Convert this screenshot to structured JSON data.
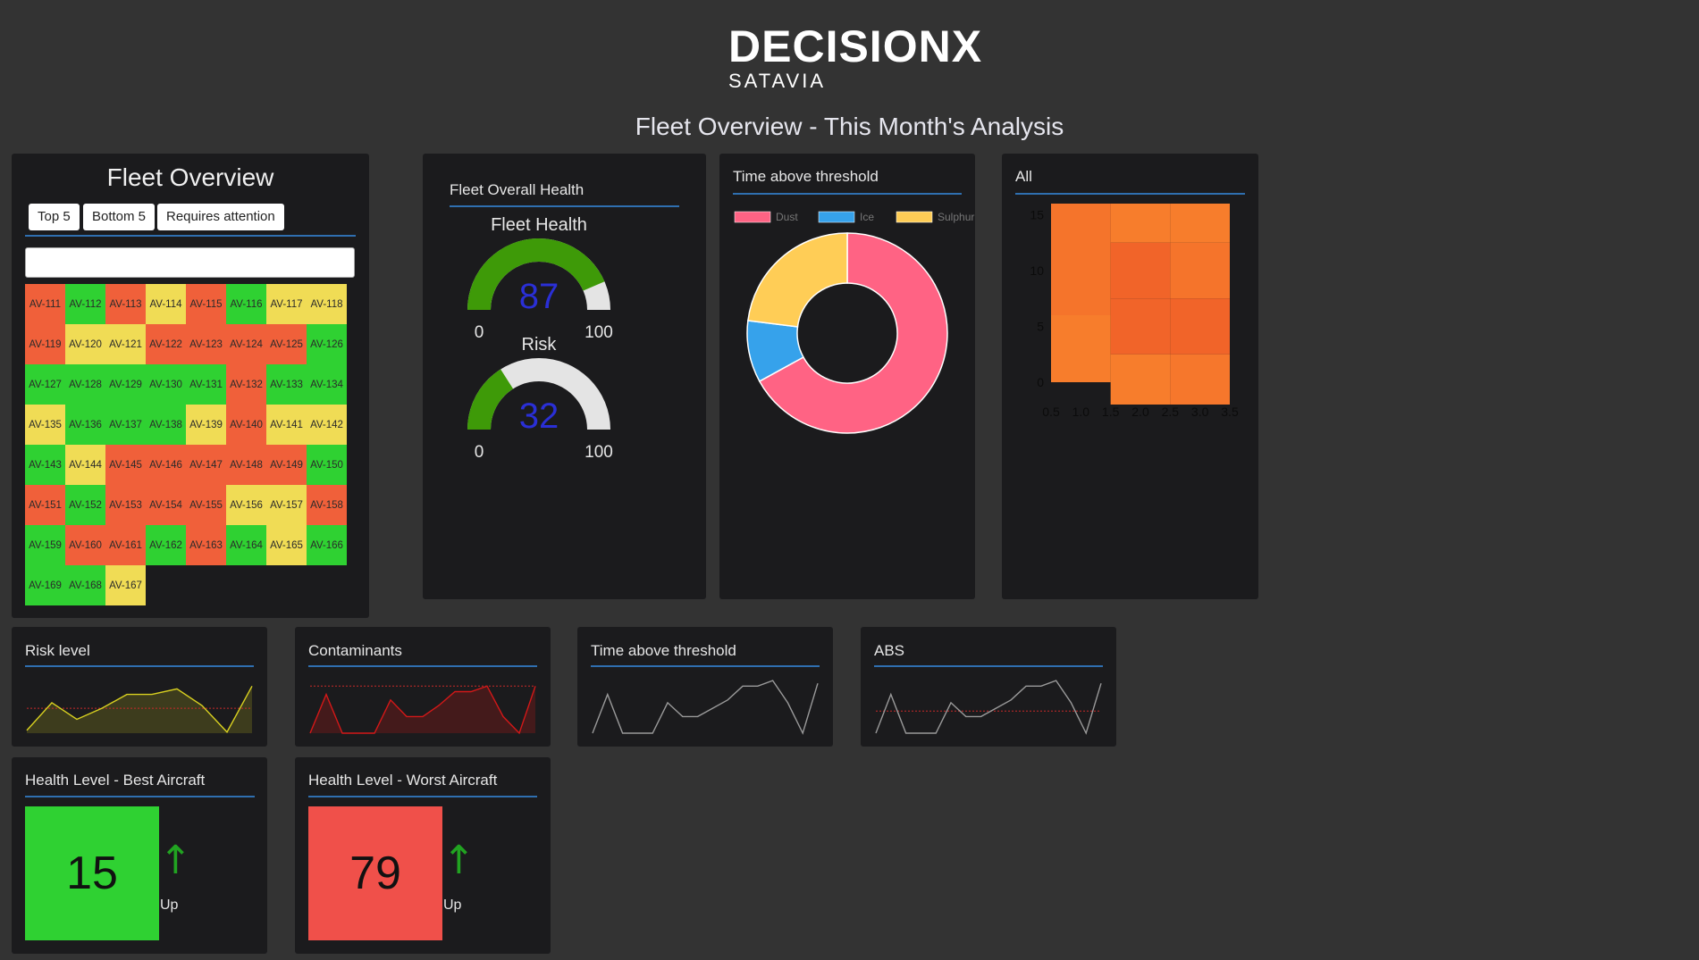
{
  "brand": {
    "logo_text": "DECISIONX",
    "sub_text": "SATAVIA",
    "accent": "#3ad6e0"
  },
  "page_title": "Fleet Overview - This Month's Analysis",
  "fleet_overview": {
    "title": "Fleet Overview",
    "buttons": [
      "Top 5",
      "Bottom 5",
      "Requires attention"
    ],
    "search": {
      "value": "",
      "placeholder": ""
    },
    "colors": {
      "red": "#f0603a",
      "green": "#2fd132",
      "yellow": "#f0dc55"
    },
    "aircraft": [
      {
        "id": "AV-111",
        "s": "red"
      },
      {
        "id": "AV-112",
        "s": "green"
      },
      {
        "id": "AV-113",
        "s": "red"
      },
      {
        "id": "AV-114",
        "s": "yellow"
      },
      {
        "id": "AV-115",
        "s": "red"
      },
      {
        "id": "AV-116",
        "s": "green"
      },
      {
        "id": "AV-117",
        "s": "yellow"
      },
      {
        "id": "AV-118",
        "s": "yellow"
      },
      {
        "id": "AV-119",
        "s": "red"
      },
      {
        "id": "AV-120",
        "s": "yellow"
      },
      {
        "id": "AV-121",
        "s": "yellow"
      },
      {
        "id": "AV-122",
        "s": "red"
      },
      {
        "id": "AV-123",
        "s": "red"
      },
      {
        "id": "AV-124",
        "s": "red"
      },
      {
        "id": "AV-125",
        "s": "red"
      },
      {
        "id": "AV-126",
        "s": "green"
      },
      {
        "id": "AV-127",
        "s": "green"
      },
      {
        "id": "AV-128",
        "s": "green"
      },
      {
        "id": "AV-129",
        "s": "green"
      },
      {
        "id": "AV-130",
        "s": "green"
      },
      {
        "id": "AV-131",
        "s": "green"
      },
      {
        "id": "AV-132",
        "s": "red"
      },
      {
        "id": "AV-133",
        "s": "green"
      },
      {
        "id": "AV-134",
        "s": "green"
      },
      {
        "id": "AV-135",
        "s": "yellow"
      },
      {
        "id": "AV-136",
        "s": "green"
      },
      {
        "id": "AV-137",
        "s": "green"
      },
      {
        "id": "AV-138",
        "s": "green"
      },
      {
        "id": "AV-139",
        "s": "yellow"
      },
      {
        "id": "AV-140",
        "s": "red"
      },
      {
        "id": "AV-141",
        "s": "yellow"
      },
      {
        "id": "AV-142",
        "s": "yellow"
      },
      {
        "id": "AV-143",
        "s": "green"
      },
      {
        "id": "AV-144",
        "s": "yellow"
      },
      {
        "id": "AV-145",
        "s": "red"
      },
      {
        "id": "AV-146",
        "s": "red"
      },
      {
        "id": "AV-147",
        "s": "red"
      },
      {
        "id": "AV-148",
        "s": "red"
      },
      {
        "id": "AV-149",
        "s": "red"
      },
      {
        "id": "AV-150",
        "s": "green"
      },
      {
        "id": "AV-151",
        "s": "red"
      },
      {
        "id": "AV-152",
        "s": "green"
      },
      {
        "id": "AV-153",
        "s": "red"
      },
      {
        "id": "AV-154",
        "s": "red"
      },
      {
        "id": "AV-155",
        "s": "red"
      },
      {
        "id": "AV-156",
        "s": "yellow"
      },
      {
        "id": "AV-157",
        "s": "yellow"
      },
      {
        "id": "AV-158",
        "s": "red"
      },
      {
        "id": "AV-159",
        "s": "green"
      },
      {
        "id": "AV-160",
        "s": "red"
      },
      {
        "id": "AV-161",
        "s": "red"
      },
      {
        "id": "AV-162",
        "s": "green"
      },
      {
        "id": "AV-163",
        "s": "red"
      },
      {
        "id": "AV-164",
        "s": "green"
      },
      {
        "id": "AV-165",
        "s": "yellow"
      },
      {
        "id": "AV-166",
        "s": "green"
      },
      {
        "id": "AV-169",
        "s": "green"
      },
      {
        "id": "AV-168",
        "s": "green"
      },
      {
        "id": "AV-167",
        "s": "yellow"
      }
    ]
  },
  "fleet_health": {
    "panel_title": "Fleet Overall Health",
    "gauges": [
      {
        "label": "Fleet Health",
        "value": 87,
        "min": 0,
        "max": 100,
        "value_text": "87",
        "min_text": "0",
        "max_text": "100"
      },
      {
        "label": "Risk",
        "value": 32,
        "min": 0,
        "max": 100,
        "value_text": "32",
        "min_text": "0",
        "max_text": "100"
      }
    ],
    "gauge_color": "#3e9a08",
    "value_color": "#2a2fd6"
  },
  "time_above_threshold_donut": {
    "panel_title": "Time above threshold",
    "chart_data": {
      "type": "pie",
      "style": "doughnut",
      "labels": [
        "Dust",
        "Ice",
        "Sulphur"
      ],
      "values": [
        67,
        10,
        23
      ],
      "colors": [
        "#ff6384",
        "#36a2eb",
        "#ffcd56"
      ],
      "legend_position": "top"
    }
  },
  "all_heatmap": {
    "panel_title": "All",
    "chart_data": {
      "type": "heatmap",
      "x_ticks": [
        "0.5",
        "1.0",
        "1.5",
        "2.0",
        "2.5",
        "3.0",
        "3.5"
      ],
      "y_ticks": [
        "15",
        "10",
        "5",
        "0"
      ],
      "xlim": [
        0.5,
        3.5
      ],
      "ylim": [
        -2,
        16
      ],
      "cells": [
        {
          "x0": 0.5,
          "x1": 1.5,
          "y0": 11,
          "y1": 16,
          "v": 0.6
        },
        {
          "x0": 1.5,
          "x1": 2.5,
          "y0": 12.5,
          "y1": 16,
          "v": 0.45
        },
        {
          "x0": 2.5,
          "x1": 3.5,
          "y0": 12.5,
          "y1": 16,
          "v": 0.45
        },
        {
          "x0": 0.5,
          "x1": 1.5,
          "y0": 6,
          "y1": 11,
          "v": 0.6
        },
        {
          "x0": 1.5,
          "x1": 2.5,
          "y0": 7.5,
          "y1": 12.5,
          "v": 0.85
        },
        {
          "x0": 2.5,
          "x1": 3.5,
          "y0": 7.5,
          "y1": 12.5,
          "v": 0.6
        },
        {
          "x0": 0.5,
          "x1": 1.5,
          "y0": 0,
          "y1": 6,
          "v": 0.45
        },
        {
          "x0": 1.5,
          "x1": 2.5,
          "y0": 2.5,
          "y1": 7.5,
          "v": 0.85
        },
        {
          "x0": 2.5,
          "x1": 3.5,
          "y0": 2.5,
          "y1": 7.5,
          "v": 0.85
        },
        {
          "x0": 1.5,
          "x1": 2.5,
          "y0": -2,
          "y1": 2.5,
          "v": 0.45
        },
        {
          "x0": 2.5,
          "x1": 3.5,
          "y0": -2,
          "y1": 2.5,
          "v": 0.55
        }
      ],
      "color_low": "#ff9a30",
      "color_high": "#ee5a28"
    }
  },
  "sparklines": [
    {
      "title": "Risk level",
      "line_color": "#d8d020",
      "fill_color": "rgba(216,208,32,0.18)",
      "fill": true,
      "threshold": 0.45,
      "threshold_color": "#c82a2a",
      "values": [
        0.05,
        0.55,
        0.25,
        0.45,
        0.7,
        0.7,
        0.8,
        0.5,
        0.02,
        0.85
      ]
    },
    {
      "title": "Contaminants",
      "line_color": "#d41818",
      "fill_color": "rgba(212,24,24,0.22)",
      "fill": true,
      "threshold": 0.85,
      "threshold_color": "#c82a2a",
      "values": [
        0.0,
        0.7,
        0.0,
        0.0,
        0.0,
        0.6,
        0.3,
        0.3,
        0.5,
        0.75,
        0.75,
        0.85,
        0.3,
        0.0,
        0.85
      ]
    },
    {
      "title": "Time above threshold",
      "line_color": "#9a9a9a",
      "fill": false,
      "threshold": null,
      "values": [
        0.0,
        0.7,
        0.0,
        0.0,
        0.0,
        0.55,
        0.3,
        0.3,
        0.45,
        0.6,
        0.85,
        0.85,
        0.95,
        0.55,
        0.0,
        0.9
      ]
    },
    {
      "title": "ABS",
      "line_color": "#9a9a9a",
      "fill": false,
      "threshold": 0.4,
      "threshold_color": "#c82a2a",
      "values": [
        0.0,
        0.7,
        0.0,
        0.0,
        0.0,
        0.55,
        0.3,
        0.3,
        0.45,
        0.6,
        0.85,
        0.85,
        0.95,
        0.55,
        0.0,
        0.9
      ]
    }
  ],
  "health_best": {
    "title": "Health Level - Best Aircraft",
    "value": "15",
    "trend": "↑",
    "trend_text": "Up",
    "color": "#2fd132"
  },
  "health_worst": {
    "title": "Health Level - Worst Aircraft",
    "value": "79",
    "trend": "↑",
    "trend_text": "Up",
    "color": "#f0504a"
  }
}
